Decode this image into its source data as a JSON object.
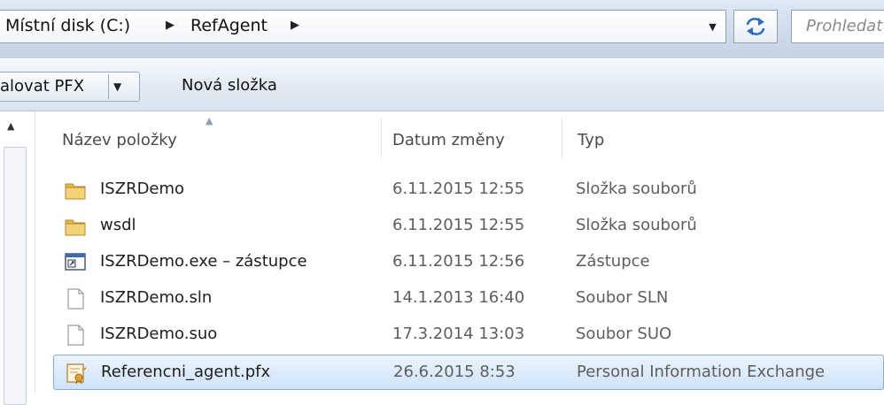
{
  "address_bar": {
    "breadcrumbs": [
      "Místní disk (C:)",
      "RefAgent"
    ],
    "search_placeholder": "Prohledat"
  },
  "toolbar": {
    "install_label": "alovat PFX",
    "new_folder_label": "Nová složka"
  },
  "columns": {
    "name": "Název položky",
    "date": "Datum změny",
    "type": "Typ"
  },
  "files": [
    {
      "name": "ISZRDemo",
      "date": "6.11.2015 12:55",
      "type": "Složka souborů",
      "icon": "folder-icon"
    },
    {
      "name": "wsdl",
      "date": "6.11.2015 12:55",
      "type": "Složka souborů",
      "icon": "folder-icon"
    },
    {
      "name": "ISZRDemo.exe – zástupce",
      "date": "6.11.2015 12:56",
      "type": "Zástupce",
      "icon": "shortcut-icon"
    },
    {
      "name": "ISZRDemo.sln",
      "date": "14.1.2013 16:40",
      "type": "Soubor SLN",
      "icon": "file-icon"
    },
    {
      "name": "ISZRDemo.suo",
      "date": "17.3.2014 13:03",
      "type": "Soubor SUO",
      "icon": "file-icon"
    },
    {
      "name": "Referencni_agent.pfx",
      "date": "26.6.2015 8:53",
      "type": "Personal Information Exchange",
      "icon": "certificate-icon",
      "selected": true
    }
  ],
  "colors": {
    "selection_border": "#84acdd",
    "selection_fill": "#cfe3f9",
    "folder": "#e8b94a"
  }
}
